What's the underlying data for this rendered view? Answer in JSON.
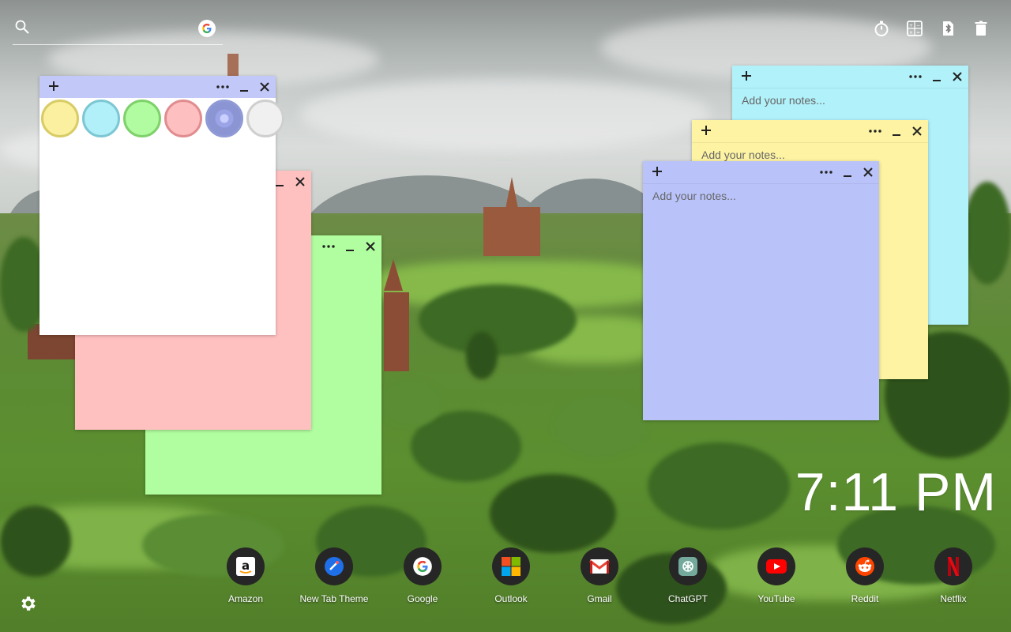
{
  "search": {
    "placeholder": "",
    "engine_icon": "google-g-icon"
  },
  "top_icons": [
    {
      "name": "timer-icon"
    },
    {
      "name": "calculator-icon"
    },
    {
      "name": "bluetooth-file-icon"
    },
    {
      "name": "trash-icon"
    }
  ],
  "notes": {
    "placeholder": "Add your notes...",
    "palette_note": {
      "header_color": "#c2c8f8",
      "body_color": "#ffffff",
      "swatches": [
        {
          "name": "yellow-swatch",
          "fill": "#fbf09f",
          "ring": "#d8cc66"
        },
        {
          "name": "cyan-swatch",
          "fill": "#b2f0f9",
          "ring": "#7cc7d3"
        },
        {
          "name": "green-swatch",
          "fill": "#b1fba0",
          "ring": "#7fd16b"
        },
        {
          "name": "pink-swatch",
          "fill": "#fdbfc0",
          "ring": "#e18d90"
        },
        {
          "name": "blue-swatch",
          "fill": "#b8c1f9",
          "ring": "#8f9ad6",
          "selected": true
        },
        {
          "name": "white-swatch",
          "fill": "#f0f0f0",
          "ring": "#cfcfcf"
        }
      ]
    },
    "pink_note": {
      "color": "#ffc0c0",
      "header": "#ffc0c0"
    },
    "green_note": {
      "color": "#b1fea0",
      "header": "#b1fea0"
    },
    "cyan_note": {
      "color": "#b1f1fa",
      "header": "#b1f1fa"
    },
    "yellow_note": {
      "color": "#fdf3a3",
      "header": "#fdf3a3"
    },
    "blue_note": {
      "color": "#b9c3fa",
      "header": "#b9c3fa"
    }
  },
  "clock": {
    "time": "7:11 PM"
  },
  "shortcuts": [
    {
      "label": "Amazon",
      "icon": "amazon-icon"
    },
    {
      "label": "New Tab Theme",
      "icon": "new-tab-theme-icon"
    },
    {
      "label": "Google",
      "icon": "google-icon"
    },
    {
      "label": "Outlook",
      "icon": "outlook-icon"
    },
    {
      "label": "Gmail",
      "icon": "gmail-icon"
    },
    {
      "label": "ChatGPT",
      "icon": "chatgpt-icon"
    },
    {
      "label": "YouTube",
      "icon": "youtube-icon"
    },
    {
      "label": "Reddit",
      "icon": "reddit-icon"
    },
    {
      "label": "Netflix",
      "icon": "netflix-icon"
    }
  ]
}
